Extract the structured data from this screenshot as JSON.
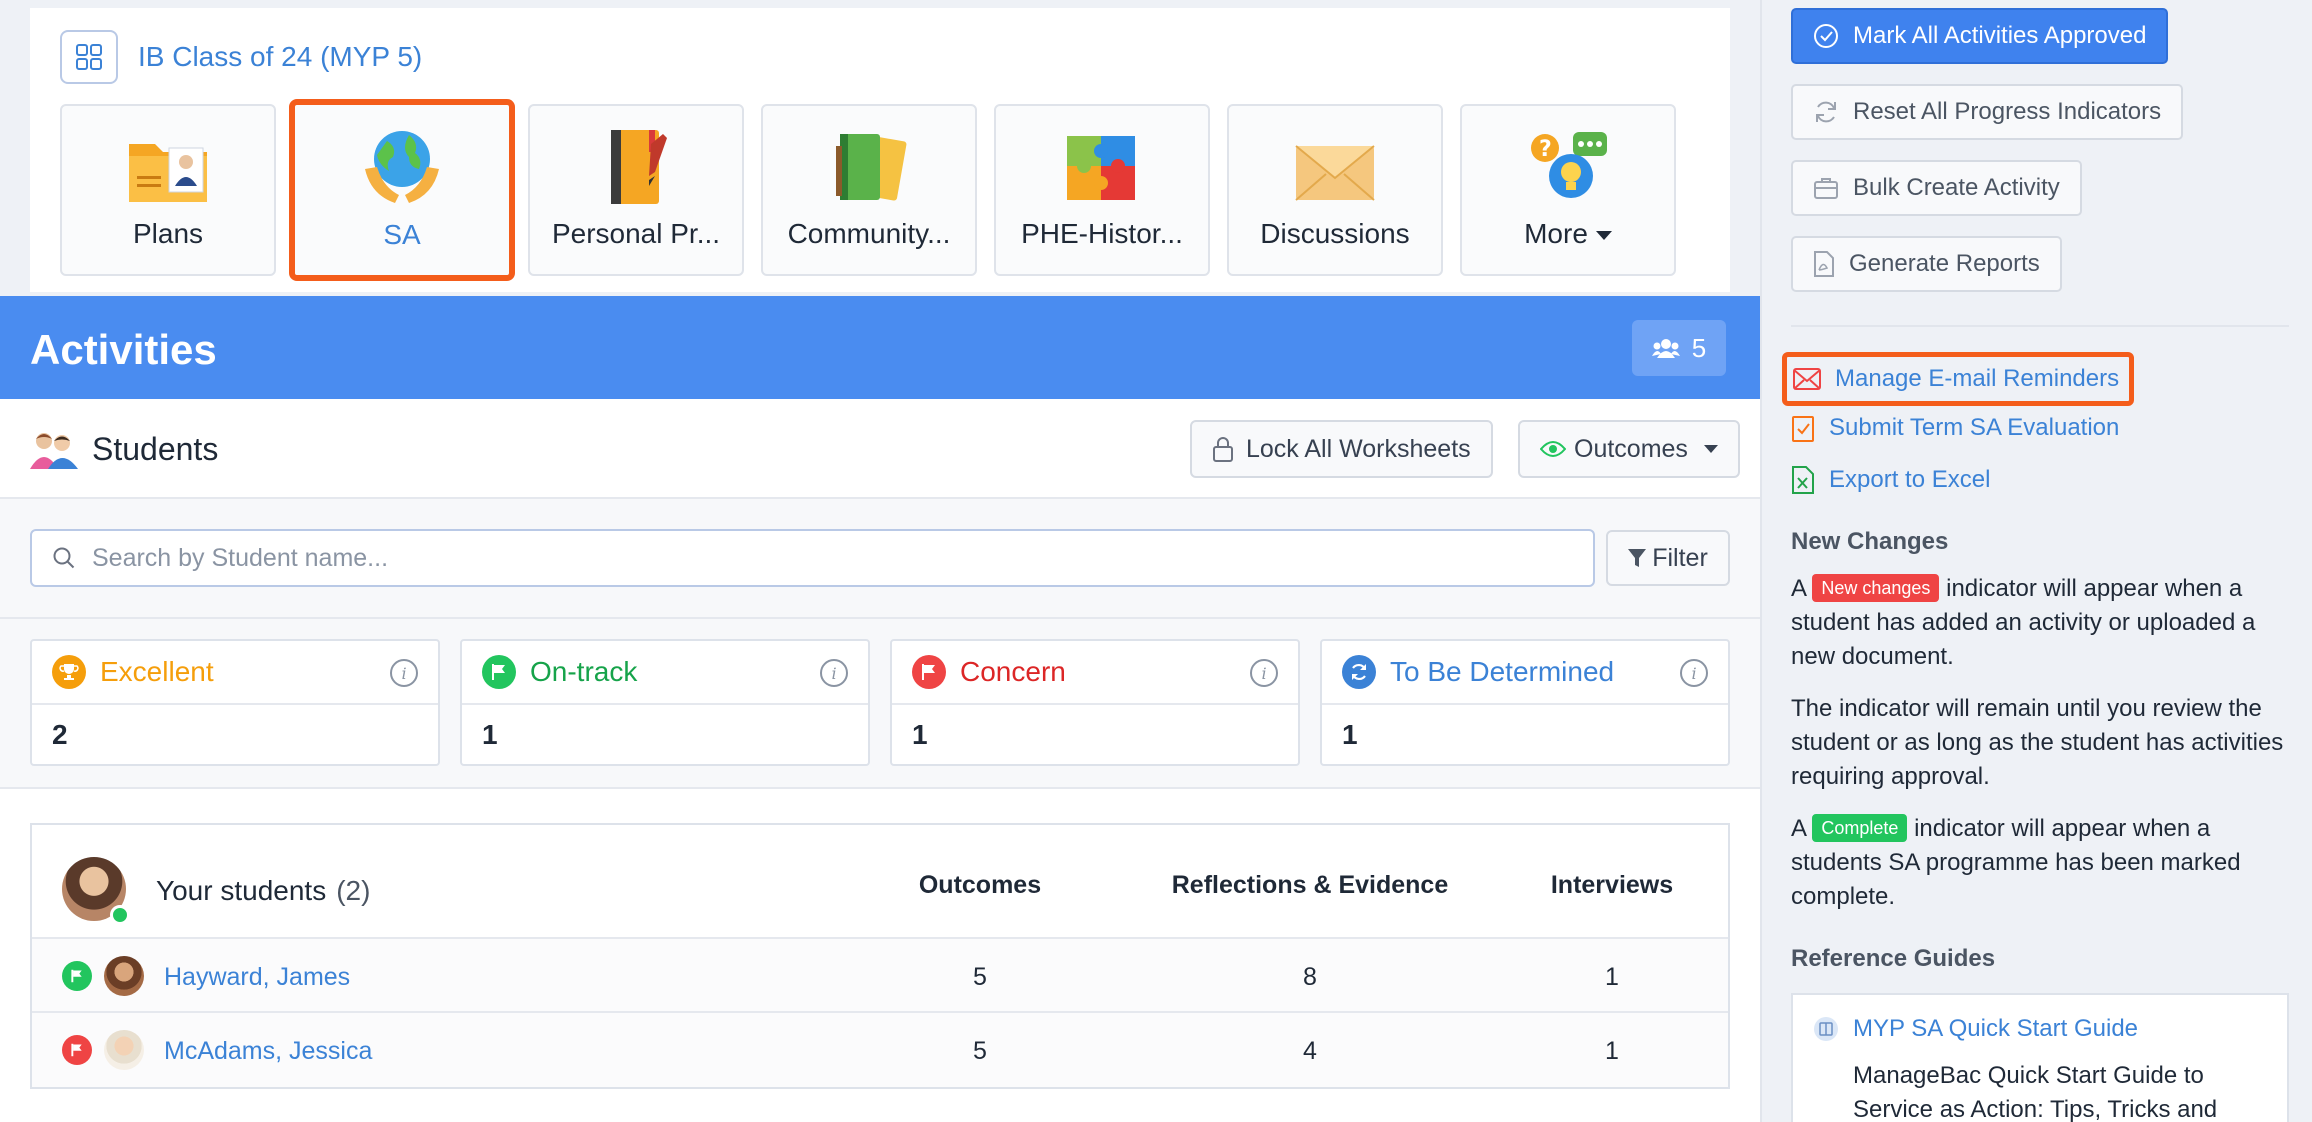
{
  "class_card": {
    "title": "IB Class of 24 (MYP 5)",
    "tiles": [
      {
        "label": "Plans",
        "icon": "folder-user-icon"
      },
      {
        "label": "SA",
        "icon": "globe-hands-icon"
      },
      {
        "label": "Personal Pr...",
        "icon": "notebook-icon"
      },
      {
        "label": "Community...",
        "icon": "books-icon"
      },
      {
        "label": "PHE-Histor...",
        "icon": "puzzle-icon"
      },
      {
        "label": "Discussions",
        "icon": "envelope-icon"
      },
      {
        "label": "More",
        "icon": "help-chat-icon"
      }
    ]
  },
  "banner": {
    "title": "Activities",
    "count": "5"
  },
  "students": {
    "title": "Students",
    "lock_label": "Lock All Worksheets",
    "outcomes_label": "Outcomes",
    "search_placeholder": "Search by Student name...",
    "filter_label": "Filter"
  },
  "status_cards": [
    {
      "label": "Excellent",
      "value": "2",
      "color": "#f59e0b"
    },
    {
      "label": "On-track",
      "value": "1",
      "color": "#22c55e"
    },
    {
      "label": "Concern",
      "value": "1",
      "color": "#ef4444"
    },
    {
      "label": "To Be Determined",
      "value": "1",
      "color": "#3b82d6"
    }
  ],
  "table": {
    "title": "Your students",
    "count": "(2)",
    "columns": [
      "Outcomes",
      "Reflections & Evidence",
      "Interviews"
    ],
    "rows": [
      {
        "name": "Hayward, James",
        "outcomes": "5",
        "reflections": "8",
        "interviews": "1",
        "flag_color": "#22c55e"
      },
      {
        "name": "McAdams, Jessica",
        "outcomes": "5",
        "reflections": "4",
        "interviews": "1",
        "flag_color": "#ef4444"
      }
    ]
  },
  "sidebar": {
    "buttons": [
      "Mark All Activities Approved",
      "Reset All Progress Indicators",
      "Bulk Create Activity",
      "Generate Reports"
    ],
    "links": [
      "Manage E-mail Reminders",
      "Submit Term SA Evaluation",
      "Export to Excel"
    ],
    "new_changes": {
      "heading": "New Changes",
      "p1_a": "A",
      "p1_badge": "New changes",
      "p1_b": "indicator will appear when a student has added an activity or uploaded a new document.",
      "p2": "The indicator will remain until you review the student or as long as the student has activities requiring approval.",
      "p3_a": "A",
      "p3_badge": "Complete",
      "p3_b": "indicator will appear when a students SA programme has been marked complete."
    },
    "reference": {
      "heading": "Reference Guides",
      "guide_title": "MYP SA Quick Start Guide",
      "guide_desc": "ManageBac Quick Start Guide to Service as Action: Tips, Tricks and"
    }
  }
}
